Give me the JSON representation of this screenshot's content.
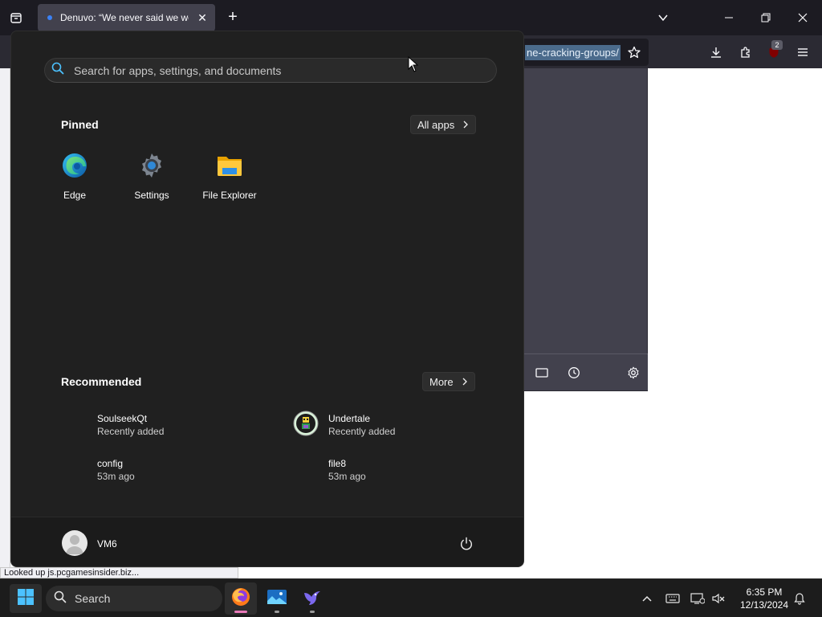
{
  "browser": {
    "tab_title": "Denuvo: “We never said we were",
    "url_selected_text": "ne-cracking-groups/",
    "extension_badge": "2"
  },
  "start_menu": {
    "search_placeholder": "Search for apps, settings, and documents",
    "pinned_title": "Pinned",
    "all_apps_label": "All apps",
    "pinned": [
      {
        "label": "Edge",
        "icon": "edge-icon"
      },
      {
        "label": "Settings",
        "icon": "settings-gear-icon"
      },
      {
        "label": "File Explorer",
        "icon": "folder-icon"
      }
    ],
    "recommended_title": "Recommended",
    "more_label": "More",
    "recommended": [
      {
        "name": "SoulseekQt",
        "sub": "Recently added"
      },
      {
        "name": "Undertale",
        "sub": "Recently added"
      },
      {
        "name": "config",
        "sub": "53m ago"
      },
      {
        "name": "file8",
        "sub": "53m ago"
      }
    ],
    "user_name": "VM6"
  },
  "status_text": "Looked up js.pcgamesinsider.biz...",
  "taskbar": {
    "search_label": "Search",
    "time": "6:35 PM",
    "date": "12/13/2024"
  },
  "colors": {
    "start_bg": "#202020",
    "taskbar_bg": "#1c1c1c",
    "accent": "#4cc2ff",
    "firefox_indicator": "#e879b8"
  }
}
